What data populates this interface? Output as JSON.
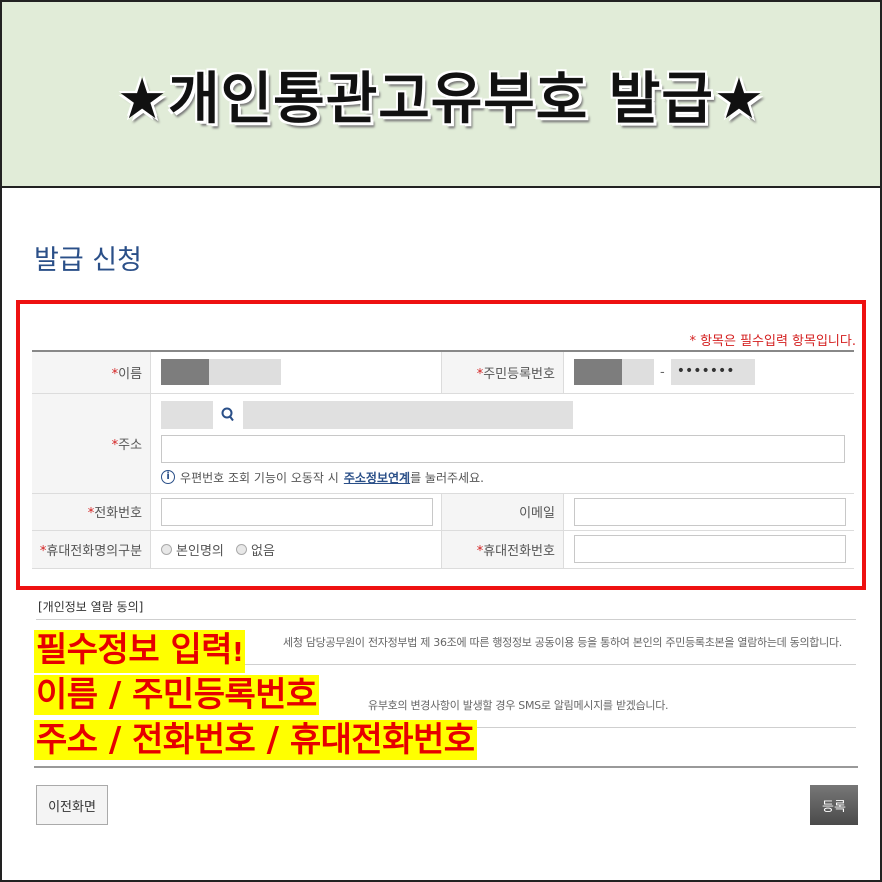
{
  "banner": {
    "title": "★개인통관고유부호 발급★"
  },
  "section": {
    "title": "발급 신청"
  },
  "form": {
    "required_note": "* 항목은 필수입력 항목입니다.",
    "name_label": "이름",
    "rrn_label": "주민등록번호",
    "rrn_back_masked": "•••••••",
    "address_label": "주소",
    "address_info": "우편번호 조회 기능이 오동작 시",
    "address_link": "주소정보연계",
    "address_info_tail": "를 눌러주세요.",
    "phone_label": "전화번호",
    "email_label": "이메일",
    "mobile_type_label": "휴대전화명의구분",
    "mobile_type_options": [
      "본인명의",
      "없음"
    ],
    "mobile_label": "휴대전화번호",
    "required_mark": "*"
  },
  "consent": {
    "title": "[개인정보 열람 동의]",
    "line1": "세청 담당공무원이 전자정부법 제 36조에 따른 행정정보 공동이용 등을 통하여 본인의 주민등록초본을 열람하는데 동의합니다.",
    "line2": "유부호의 변경사항이 발생할 경우 SMS로 알림메시지를 받겠습니다."
  },
  "overlay": {
    "line1": "필수정보 입력",
    "line1_mark": "!",
    "line2": "이름 / 주민등록번호",
    "line3": "주소 / 전화번호 / 휴대전화번호"
  },
  "buttons": {
    "prev": "이전화면",
    "submit": "등록"
  },
  "colors": {
    "banner_bg": "#e1ecd8",
    "highlight_border": "#ee1111",
    "overlay_text": "#e60000",
    "overlay_bg": "#ffff00",
    "title_blue": "#2a4f88"
  }
}
